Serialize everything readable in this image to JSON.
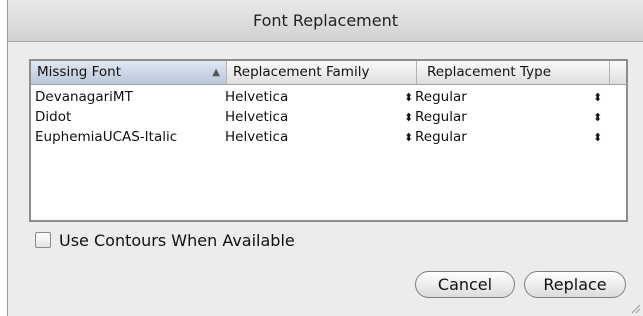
{
  "window": {
    "title": "Font Replacement"
  },
  "table": {
    "columns": [
      {
        "label": "Missing Font",
        "sorted": true,
        "sort_direction": "ascending"
      },
      {
        "label": "Replacement Family"
      },
      {
        "label": "Replacement Type"
      }
    ],
    "rows": [
      {
        "missing_font": "DevanagariMT",
        "replacement_family": "Helvetica",
        "replacement_type": "Regular"
      },
      {
        "missing_font": "Didot",
        "replacement_family": "Helvetica",
        "replacement_type": "Regular"
      },
      {
        "missing_font": "EuphemiaUCAS-Italic",
        "replacement_family": "Helvetica",
        "replacement_type": "Regular"
      }
    ]
  },
  "options": {
    "use_contours_label": "Use Contours When Available",
    "use_contours_checked": false
  },
  "buttons": {
    "cancel_label": "Cancel",
    "replace_label": "Replace"
  },
  "icons": {
    "sort": "sort-ascending-icon",
    "stepper": "up-down-arrows-icon",
    "resize": "resize-grip-icon"
  }
}
